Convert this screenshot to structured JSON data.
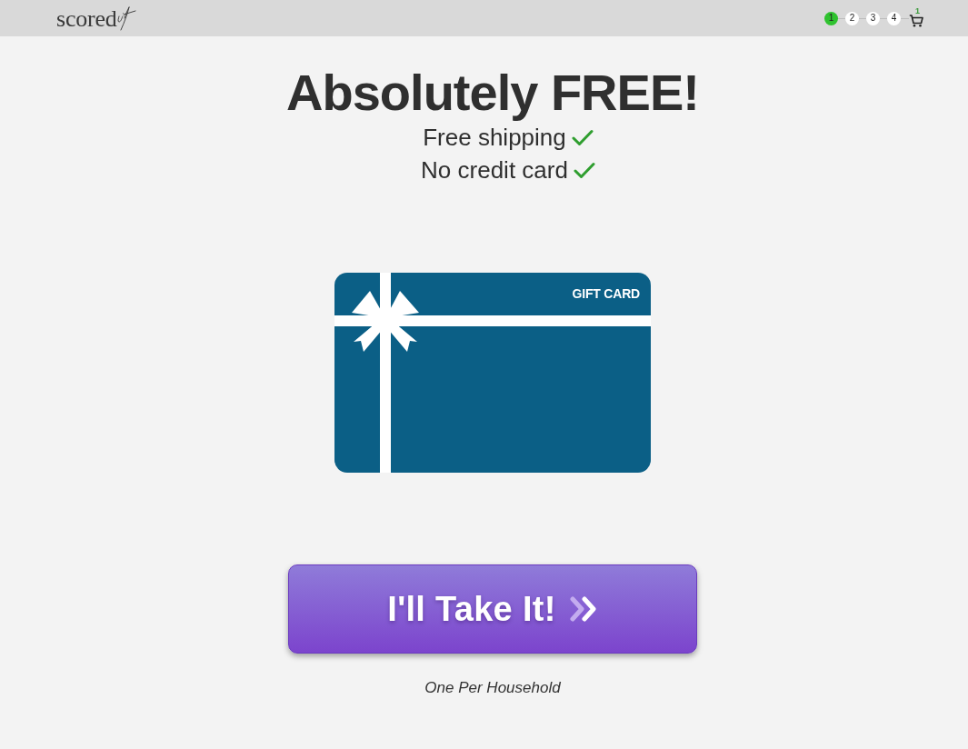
{
  "header": {
    "logo": {
      "wordmark": "scored"
    },
    "steps": [
      {
        "label": "1",
        "selected": true
      },
      {
        "label": "2",
        "selected": false
      },
      {
        "label": "3",
        "selected": false
      },
      {
        "label": "4",
        "selected": false
      }
    ],
    "cart": {
      "count": "1"
    }
  },
  "headline": "Absolutely FREE!",
  "benefits": [
    {
      "text": "Free shipping",
      "checked": true
    },
    {
      "text": "No credit card",
      "checked": true
    }
  ],
  "gift_card": {
    "label": "GIFT CARD"
  },
  "cta": {
    "label": "I'll Take It!"
  },
  "note": "One Per Household"
}
